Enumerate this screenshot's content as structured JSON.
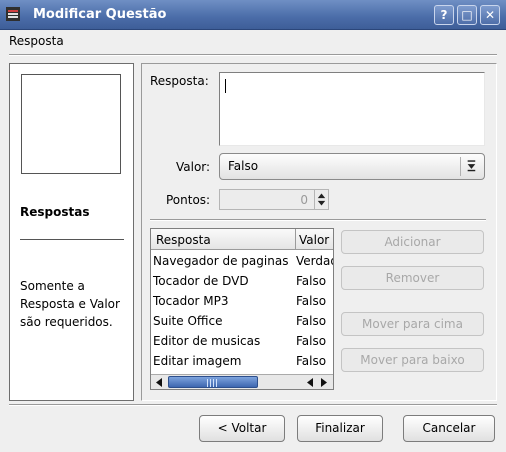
{
  "window": {
    "title": "Modificar Questão"
  },
  "title_buttons": {
    "help": "?",
    "maximize": "□",
    "close": "✕"
  },
  "header": {
    "title": "Resposta"
  },
  "left_panel": {
    "title": "Respostas",
    "help_text": "Somente a Resposta e Valor são requeridos."
  },
  "form": {
    "resposta_label": "Resposta:",
    "resposta_value": "",
    "valor_label": "Valor:",
    "valor_value": "Falso",
    "pontos_label": "Pontos:",
    "pontos_value": "0"
  },
  "table": {
    "columns": [
      "Resposta",
      "Valor"
    ],
    "rows": [
      [
        "Navegador de paginas",
        "Verdadeiro"
      ],
      [
        "Tocador de DVD",
        "Falso"
      ],
      [
        "Tocador MP3",
        "Falso"
      ],
      [
        "Suite Office",
        "Falso"
      ],
      [
        "Editor de musicas",
        "Falso"
      ],
      [
        "Editar imagem",
        "Falso"
      ]
    ]
  },
  "side_buttons": {
    "add": "Adicionar",
    "remove": "Remover",
    "move_up": "Mover para cima",
    "move_down": "Mover para baixo"
  },
  "footer": {
    "back": "< Voltar",
    "finish": "Finalizar",
    "cancel": "Cancelar"
  },
  "icons": {
    "app": "app-menu-icon",
    "combo": "combo-arrow-icon",
    "spin_up": "spin-up-icon",
    "spin_down": "spin-down-icon",
    "scroll_left": "scroll-left-icon",
    "scroll_right": "scroll-right-icon"
  },
  "colors": {
    "titlebar": "#4a6ca8",
    "thumb": "#3e67b0",
    "disabled_text": "#a8a8a8"
  }
}
